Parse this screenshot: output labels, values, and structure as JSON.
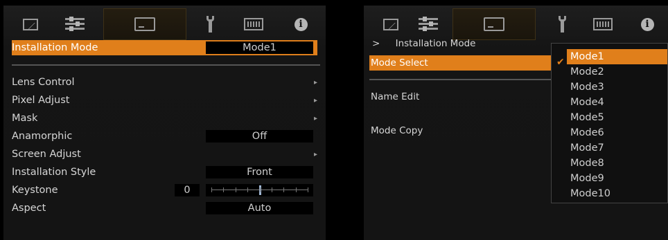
{
  "tabs": {
    "items": [
      "image-icon",
      "settings-icon",
      "screen-icon",
      "wrench-icon",
      "film-icon",
      "info-icon"
    ]
  },
  "left_menu": {
    "installation_mode": {
      "label": "Installation Mode",
      "value": "Mode1"
    },
    "lens_control": {
      "label": "Lens Control"
    },
    "pixel_adjust": {
      "label": "Pixel Adjust"
    },
    "mask": {
      "label": "Mask"
    },
    "anamorphic": {
      "label": "Anamorphic",
      "value": "Off"
    },
    "screen_adjust": {
      "label": "Screen Adjust"
    },
    "installation_style": {
      "label": "Installation Style",
      "value": "Front"
    },
    "keystone": {
      "label": "Keystone",
      "value": "0",
      "level": 0.5
    },
    "aspect": {
      "label": "Aspect",
      "value": "Auto"
    }
  },
  "right_menu": {
    "breadcrumb_marker": ">",
    "breadcrumb_title": "Installation Mode",
    "mode_select": "Mode Select",
    "name_edit": "Name Edit",
    "mode_copy": "Mode Copy"
  },
  "dropdown": {
    "selected": "Mode1",
    "options": [
      "Mode1",
      "Mode2",
      "Mode3",
      "Mode4",
      "Mode5",
      "Mode6",
      "Mode7",
      "Mode8",
      "Mode9",
      "Mode10"
    ]
  },
  "colors": {
    "accent": "#e07f1b",
    "background": "#141414"
  }
}
